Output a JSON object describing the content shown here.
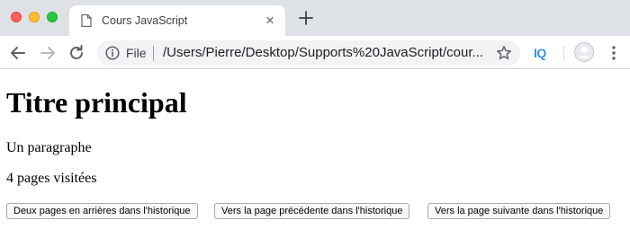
{
  "browser": {
    "tab": {
      "title": "Cours JavaScript",
      "close_glyph": "×"
    },
    "omnibox": {
      "site_chip_label": "File",
      "url": "/Users/Pierre/Desktop/Supports%20JavaScript/cour..."
    },
    "extensions": {
      "iq_label": "IQ"
    },
    "colors": {
      "tabstrip_bg": "#dee1e6",
      "traffic_close": "#ff5f57",
      "traffic_minimize": "#febc2e",
      "traffic_maximize": "#28c840",
      "iq_accent": "#3a8fd9"
    },
    "icons": [
      "back-icon",
      "forward-icon",
      "reload-icon",
      "info-icon",
      "star-icon",
      "iq-extension-icon",
      "avatar",
      "menu-icon",
      "new-tab-icon",
      "file-icon"
    ]
  },
  "page": {
    "heading": "Titre principal",
    "paragraph": "Un paragraphe",
    "visit_count_text": "4 pages visitées",
    "buttons": {
      "back_two": "Deux pages en arrières dans l'historique",
      "back_one": "Vers la page précédente dans l'historique",
      "forward_one": "Vers la page suivante dans l'historique"
    }
  }
}
